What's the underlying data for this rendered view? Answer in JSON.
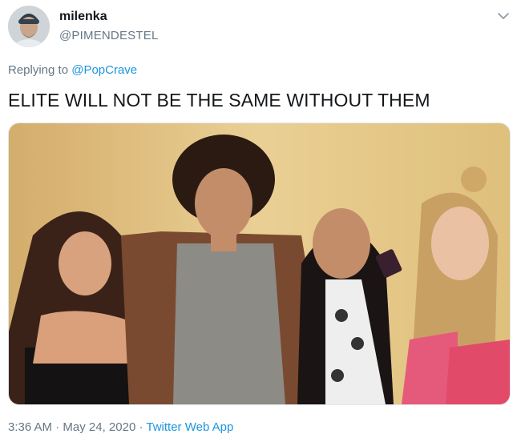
{
  "author": {
    "name": "milenka",
    "handle": "@PIMENDESTEL",
    "avatar_icon": "profile-photo"
  },
  "menu_icon": "chevron-down-icon",
  "reply": {
    "prefix": "Replying to",
    "target": "@PopCrave"
  },
  "tweet": {
    "text": "ELITE WILL NOT BE THE SAME WITHOUT THEM"
  },
  "photo": {
    "description_icon": "group-photo"
  },
  "meta": {
    "time": "3:36 AM",
    "separator": "·",
    "date": "May 24, 2020",
    "app": "Twitter Web App"
  },
  "colors": {
    "link": "#1b95e0",
    "secondary_text": "#657786",
    "primary_text": "#14171a"
  }
}
